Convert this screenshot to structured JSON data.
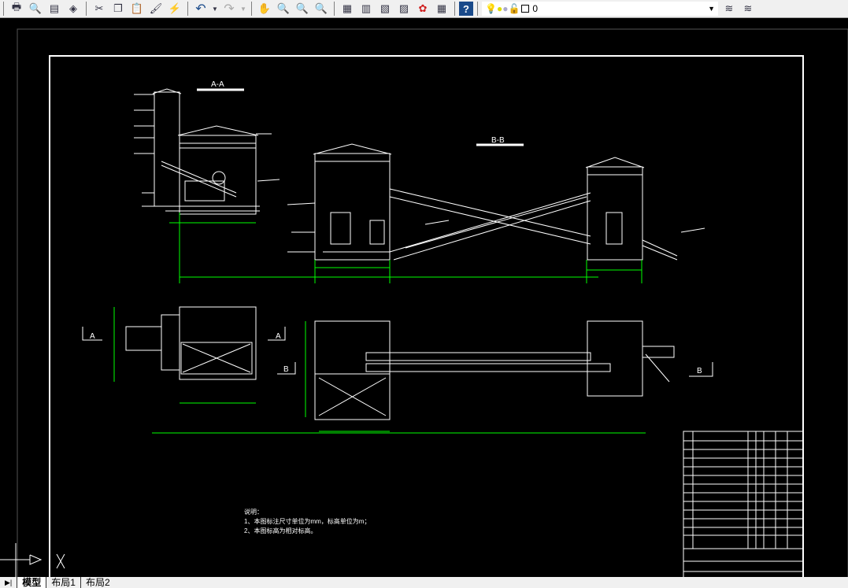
{
  "toolbar": {
    "icons": [
      "print-icon",
      "print-preview-icon",
      "publish-icon",
      "3d-dwf-icon",
      "cut-icon",
      "copy-icon",
      "paste-icon",
      "match-properties-icon",
      "block-editor-icon",
      "undo-icon",
      "undo-dropdown-icon",
      "redo-icon",
      "redo-dropdown-icon",
      "pan-icon",
      "zoom-realtime-icon",
      "zoom-window-icon",
      "zoom-previous-icon",
      "properties-icon",
      "design-center-icon",
      "tool-palettes-icon",
      "sheet-set-icon",
      "markup-icon",
      "calculator-icon",
      "help-icon"
    ],
    "layer_manager": "layer-manager-icon",
    "layer_value": "0",
    "layer_tools": [
      "make-current-layer-icon",
      "layer-previous-icon"
    ]
  },
  "drawing": {
    "section_aa": "A-A",
    "section_bb": "B-B",
    "cut_marker_a": "A",
    "cut_marker_b": "B",
    "line_color": "#ffffff",
    "dimension_color": "#00ff00"
  },
  "notes": {
    "title": "说明：",
    "items": [
      "1、本图标注尺寸单位为mm，标高单位为m；",
      "2、本图标高为相对标高。"
    ]
  },
  "tabs": {
    "items": [
      "模型",
      "布局1",
      "布局2"
    ],
    "active": "模型"
  }
}
